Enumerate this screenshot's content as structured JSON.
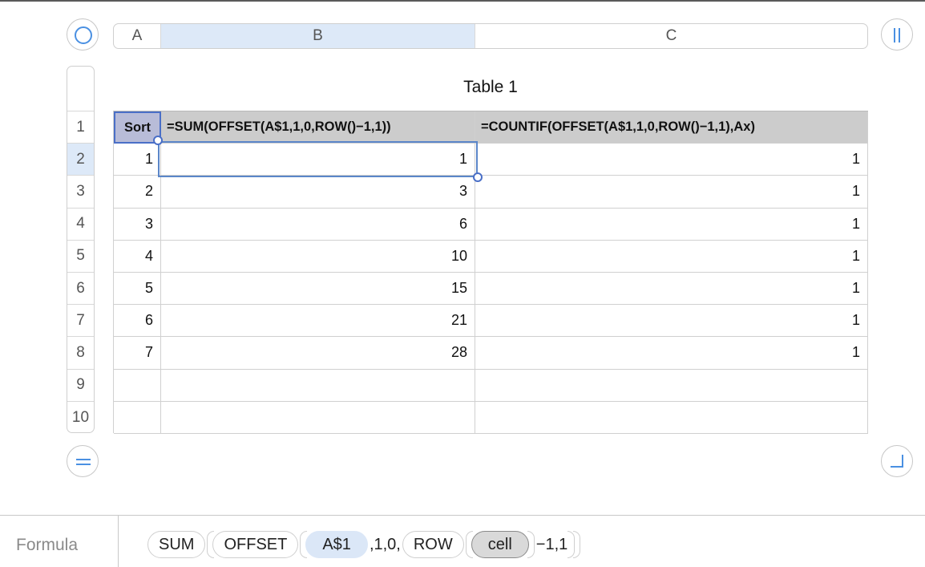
{
  "columns": [
    "A",
    "B",
    "C"
  ],
  "selected_column": "B",
  "row_numbers": [
    "1",
    "2",
    "3",
    "4",
    "5",
    "6",
    "7",
    "8",
    "9",
    "10"
  ],
  "selected_row": "2",
  "table": {
    "title": "Table 1",
    "header": [
      "Sort",
      "=SUM(OFFSET(A$1,1,0,ROW()−1,1))",
      "=COUNTIF(OFFSET(A$1,1,0,ROW()−1,1),Ax)"
    ],
    "rows": [
      [
        "1",
        "1",
        "1"
      ],
      [
        "2",
        "3",
        "1"
      ],
      [
        "3",
        "6",
        "1"
      ],
      [
        "4",
        "10",
        "1"
      ],
      [
        "5",
        "15",
        "1"
      ],
      [
        "6",
        "21",
        "1"
      ],
      [
        "7",
        "28",
        "1"
      ],
      [
        "",
        "",
        ""
      ],
      [
        "",
        "",
        ""
      ]
    ]
  },
  "formula_bar": {
    "label": "Formula",
    "fn_sum": "SUM",
    "fn_offset": "OFFSET",
    "ref_a1": "A$1",
    "args_1": ",1,0,",
    "fn_row": "ROW",
    "arg_cell": "cell",
    "args_2": "−1,1"
  },
  "colors": {
    "selection": "#5b86c9",
    "accent": "#4a90e2",
    "header_fill": "#cccccc",
    "selected_header_fill": "#dde9f8"
  }
}
